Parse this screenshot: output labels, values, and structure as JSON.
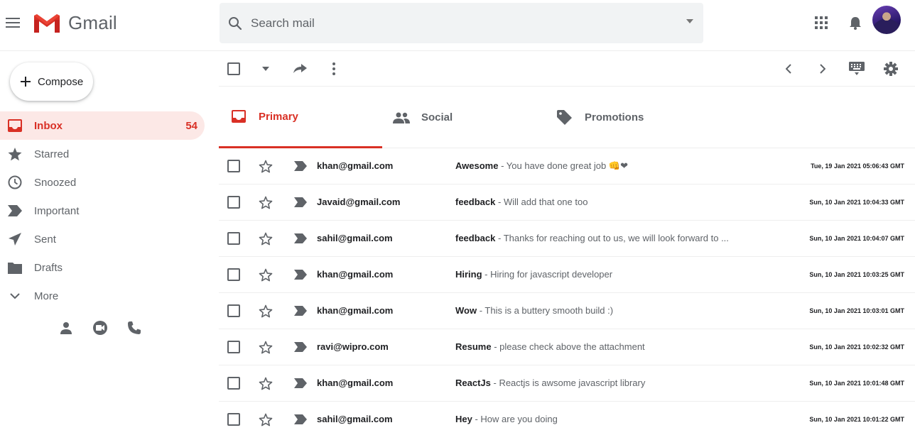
{
  "app": {
    "name": "Gmail"
  },
  "search": {
    "placeholder": "Search mail"
  },
  "sidebar": {
    "compose_label": "Compose",
    "items": [
      {
        "label": "Inbox",
        "icon": "inbox-icon",
        "count": "54",
        "active": true
      },
      {
        "label": "Starred",
        "icon": "star-icon"
      },
      {
        "label": "Snoozed",
        "icon": "clock-icon"
      },
      {
        "label": "Important",
        "icon": "label-important-icon"
      },
      {
        "label": "Sent",
        "icon": "send-icon"
      },
      {
        "label": "Drafts",
        "icon": "draft-icon"
      },
      {
        "label": "More",
        "icon": "chevron-down-icon"
      }
    ],
    "footer_icons": [
      "person-icon",
      "video-icon",
      "phone-icon"
    ]
  },
  "tabs": [
    {
      "label": "Primary",
      "icon": "inbox-icon",
      "active": true
    },
    {
      "label": "Social",
      "icon": "people-icon"
    },
    {
      "label": "Promotions",
      "icon": "tag-icon"
    }
  ],
  "colors": {
    "accent": "#d93025",
    "inbox_active_bg": "#fce8e6",
    "icon": "#5f6368"
  },
  "emails": [
    {
      "from": "khan@gmail.com",
      "subject": "Awesome",
      "snippet": "You have done great job 👊❤",
      "date": "Tue, 19 Jan 2021 05:06:43 GMT"
    },
    {
      "from": "Javaid@gmail.com",
      "subject": "feedback",
      "snippet": "Will add that one too",
      "date": "Sun, 10 Jan 2021 10:04:33 GMT"
    },
    {
      "from": "sahil@gmail.com",
      "subject": "feedback",
      "snippet": "Thanks for reaching out to us, we will look forward to ...",
      "date": "Sun, 10 Jan 2021 10:04:07 GMT"
    },
    {
      "from": "khan@gmail.com",
      "subject": "Hiring",
      "snippet": "Hiring for javascript developer",
      "date": "Sun, 10 Jan 2021 10:03:25 GMT"
    },
    {
      "from": "khan@gmail.com",
      "subject": "Wow",
      "snippet": "This is a buttery smooth build :)",
      "date": "Sun, 10 Jan 2021 10:03:01 GMT"
    },
    {
      "from": "ravi@wipro.com",
      "subject": "Resume",
      "snippet": "please check above the attachment",
      "date": "Sun, 10 Jan 2021 10:02:32 GMT"
    },
    {
      "from": "khan@gmail.com",
      "subject": "ReactJs",
      "snippet": "Reactjs is awsome javascript library",
      "date": "Sun, 10 Jan 2021 10:01:48 GMT"
    },
    {
      "from": "sahil@gmail.com",
      "subject": "Hey",
      "snippet": "How are you doing",
      "date": "Sun, 10 Jan 2021 10:01:22 GMT"
    }
  ]
}
